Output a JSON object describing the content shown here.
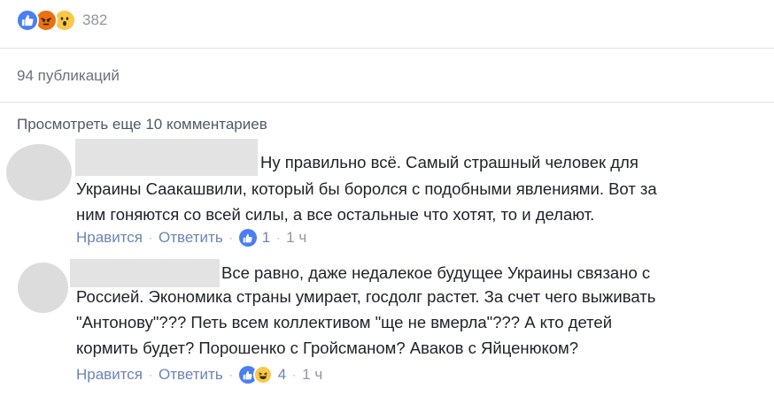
{
  "post": {
    "reactions": {
      "icons": [
        "like-icon",
        "angry-icon",
        "wow-icon"
      ],
      "count": "382"
    },
    "shares_label": "94 публикаций",
    "view_more_label": "Просмотреть еще 10 комментариев"
  },
  "colors": {
    "like_blue": "#4a7ef3",
    "angry_orange": "#e9710f",
    "wow_yellow": "#f7c948",
    "link_blue": "#6b84b5",
    "muted_gray": "#8f96a3"
  },
  "comments": [
    {
      "lines": [
        "Ну правильно всё. Самый страшный человек для",
        "Украины Саакашвили, который бы боролся с подобными явлениями. Вот за",
        "ним гоняются со всей силы, а все остальные что хотят, то и делают."
      ],
      "like_label": "Нравится",
      "reply_label": "Ответить",
      "reaction_icons": [
        "like-icon"
      ],
      "reaction_count": "1",
      "time": "1 ч"
    },
    {
      "lines": [
        "Все равно, даже недалекое будущее Украины связано с",
        "Россией. Экономика страны умирает, госдолг растет. За счет чего выживать",
        "\"Антонову\"??? Петь всем коллективом \"ще не вмерла\"??? А кто детей",
        "кормить будет? Порошенко с Гройсманом? Аваков с Яйценюком?"
      ],
      "like_label": "Нравится",
      "reply_label": "Ответить",
      "reaction_icons": [
        "like-icon",
        "laugh-icon"
      ],
      "reaction_count": "4",
      "time": "1 ч"
    }
  ]
}
